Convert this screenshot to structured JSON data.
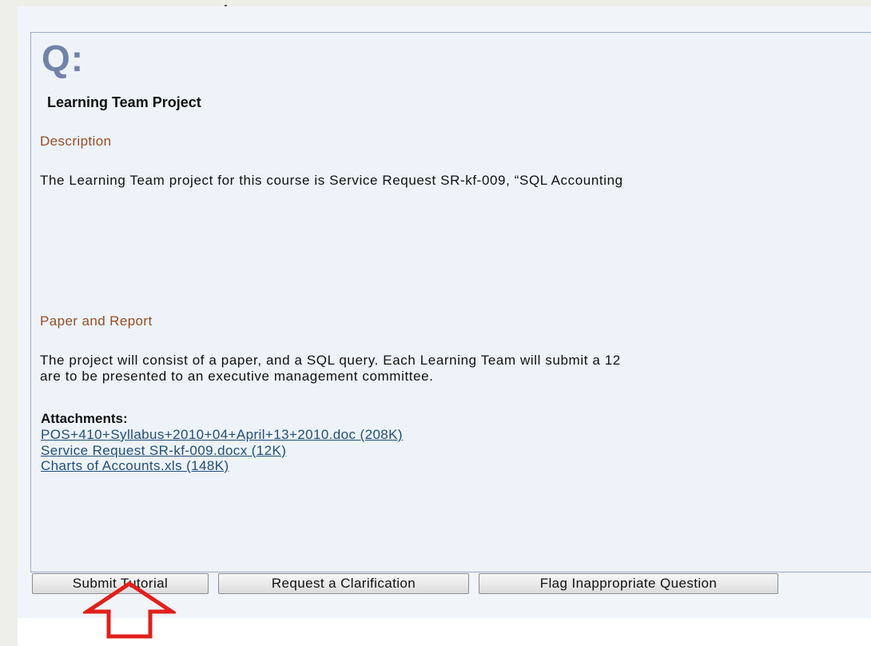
{
  "question": {
    "label": "Q:",
    "title": "Learning Team Project",
    "sections": [
      {
        "heading": "Description",
        "lines": [
          "The Learning Team project for this course is Service Request SR-kf-009, “SQL Accounting"
        ]
      },
      {
        "heading": "Paper and Report",
        "lines": [
          "The project will consist of a paper, and a SQL query.  Each Learning Team will submit a 12",
          "are to be presented to an executive management committee."
        ]
      }
    ],
    "attachments_heading": "Attachments:",
    "attachments": [
      "POS+410+Syllabus+2010+04+April+13+2010.doc (208K)",
      "Service Request SR-kf-009.docx (12K)",
      "Charts of Accounts.xls (148K)"
    ]
  },
  "buttons": {
    "submit": "Submit Tutorial",
    "clarify": "Request a Clarification",
    "flag": "Flag Inappropriate Question"
  },
  "annotation": {
    "arrow_icon": "red-up-arrow-outline",
    "arrow_color": "#e0201b"
  },
  "colors": {
    "q_label": "#7083a8",
    "section_heading": "#9a4c22",
    "link": "#1f4e7a",
    "panel_border": "#9aaac7"
  }
}
